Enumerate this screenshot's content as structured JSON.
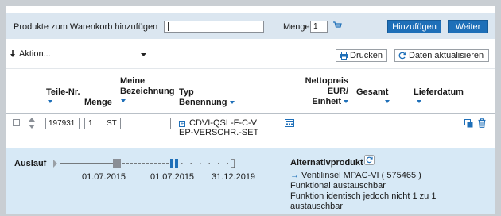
{
  "add_bar": {
    "label": "Produkte zum Warenkorb hinzufügen",
    "product_input_value": "",
    "quantity_label": "Menge",
    "quantity_value": "1",
    "add_button": "Hinzufügen",
    "next_button": "Weiter"
  },
  "action_bar": {
    "action_select": "Aktion...",
    "print_button": "Drucken",
    "refresh_button": "Daten aktualisieren"
  },
  "columns": {
    "part_no": "Teile-Nr.",
    "quantity": "Menge",
    "my_desc_1": "Meine",
    "my_desc_2": "Bezeichnung",
    "type_1": "Typ",
    "type_2": "Benennung",
    "net_1": "Nettopreis",
    "net_2": "EUR/",
    "net_3": "Einheit",
    "total": "Gesamt",
    "delivery": "Lieferdatum"
  },
  "item": {
    "part_no": "197931",
    "quantity": "1",
    "unit": "ST",
    "my_description": "",
    "type_line1": "CDVI-QSL-F-C-V",
    "type_line2": "EP-VERSCHR.-SET"
  },
  "lifecycle": {
    "label": "Auslauf",
    "date1": "01.07.2015",
    "date2": "01.07.2015",
    "date3": "31.12.2019"
  },
  "alternative": {
    "title": "Alternativprodukt",
    "link": "Ventilinsel MPAC-VI ( 575465 )",
    "text1": "Funktional austauschbar",
    "text2": "Funktion identisch jedoch nicht 1 zu 1 austauschbar"
  },
  "colors": {
    "accent": "#1e6fb8",
    "highlight_box": "#d7e9f6",
    "add_bar_bg": "#dbe6f0",
    "page_bg": "#c9ced3"
  }
}
